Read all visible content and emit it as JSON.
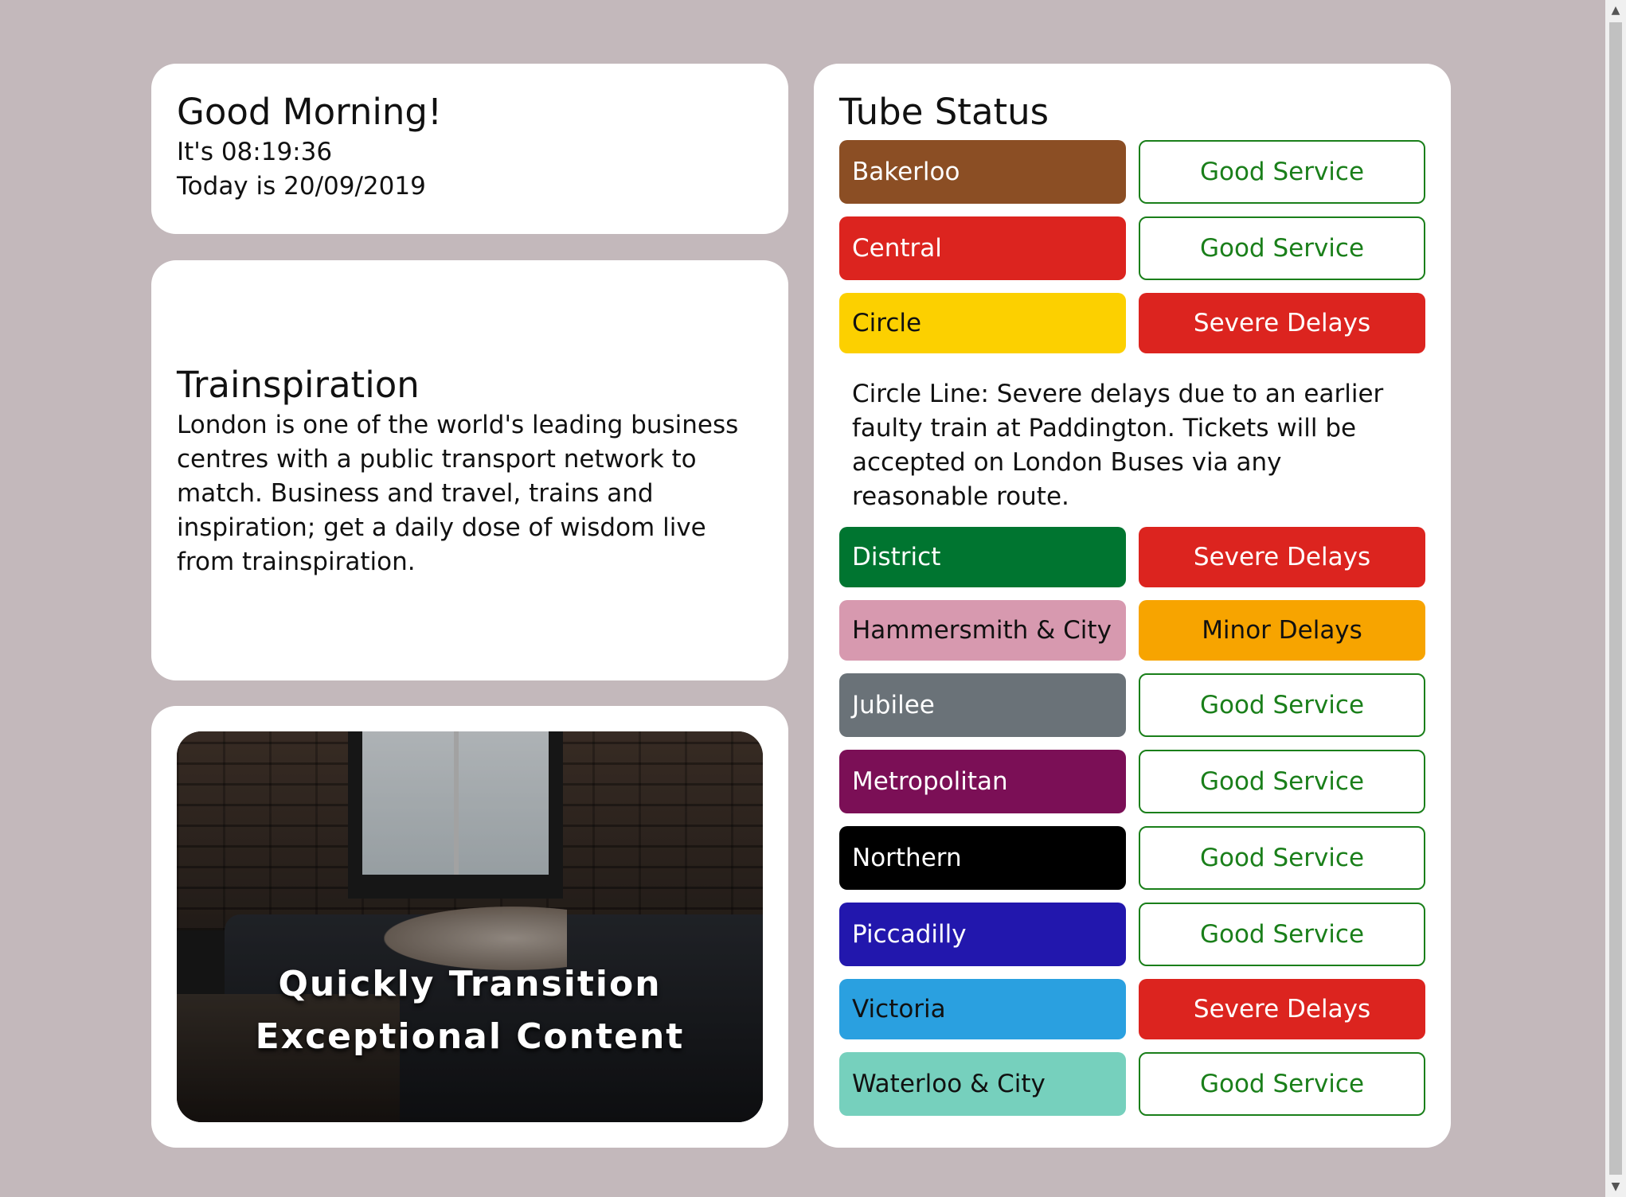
{
  "greeting": {
    "title": "Good Morning!",
    "time_line": "It's 08:19:36",
    "date_line": "Today is 20/09/2019"
  },
  "inspiration": {
    "title": "Trainspiration",
    "body": "London is one of the world's leading business centres with a public transport network to match. Business and travel, trains and inspiration; get a daily dose of wisdom live from trainspiration."
  },
  "image_card": {
    "caption_line1": "Quickly Transition",
    "caption_line2": "Exceptional Content"
  },
  "tube": {
    "title": "Tube Status",
    "lines": [
      {
        "name": "Bakerloo",
        "status": "Good Service",
        "kind": "good",
        "color": "#8b4e24",
        "text_color": "#ffffff"
      },
      {
        "name": "Central",
        "status": "Good Service",
        "kind": "good",
        "color": "#dc241f",
        "text_color": "#ffffff"
      },
      {
        "name": "Circle",
        "status": "Severe Delays",
        "kind": "severe",
        "color": "#fcd000",
        "text_color": "#111111",
        "details": "Circle Line: Severe delays due to an earlier faulty train at Paddington. Tickets will be accepted on London Buses via any reasonable route."
      },
      {
        "name": "District",
        "status": "Severe Delays",
        "kind": "severe",
        "color": "#007530",
        "text_color": "#ffffff"
      },
      {
        "name": "Hammersmith & City",
        "status": "Minor Delays",
        "kind": "minor",
        "color": "#d799af",
        "text_color": "#111111"
      },
      {
        "name": "Jubilee",
        "status": "Good Service",
        "kind": "good",
        "color": "#6a7278",
        "text_color": "#ffffff"
      },
      {
        "name": "Metropolitan",
        "status": "Good Service",
        "kind": "good",
        "color": "#7b0f56",
        "text_color": "#ffffff"
      },
      {
        "name": "Northern",
        "status": "Good Service",
        "kind": "good",
        "color": "#000000",
        "text_color": "#ffffff"
      },
      {
        "name": "Piccadilly",
        "status": "Good Service",
        "kind": "good",
        "color": "#2217ad",
        "text_color": "#ffffff"
      },
      {
        "name": "Victoria",
        "status": "Severe Delays",
        "kind": "severe",
        "color": "#2aa0e0",
        "text_color": "#111111"
      },
      {
        "name": "Waterloo & City",
        "status": "Good Service",
        "kind": "good",
        "color": "#76d0bd",
        "text_color": "#111111"
      }
    ]
  },
  "colors": {
    "background": "#c3b8bb",
    "good": "#1a7f1a",
    "severe": "#dc241f",
    "minor": "#f7a400"
  }
}
